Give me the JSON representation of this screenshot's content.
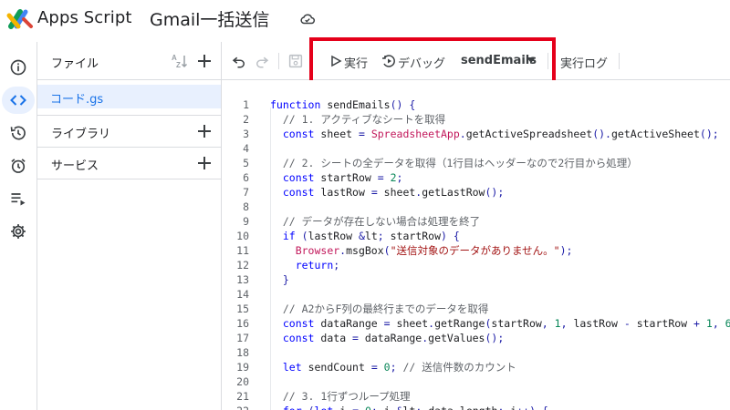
{
  "header": {
    "app_name": "Apps Script",
    "project_title": "Gmail一括送信"
  },
  "rail": {
    "items": [
      {
        "icon": "info-icon"
      },
      {
        "icon": "code-icon",
        "active": true
      },
      {
        "icon": "history-icon"
      },
      {
        "icon": "alarm-icon"
      },
      {
        "icon": "executions-icon"
      },
      {
        "icon": "gear-icon"
      }
    ]
  },
  "files": {
    "title": "ファイル",
    "sort_label": "AZ",
    "active_file": "コード.gs",
    "libraries_label": "ライブラリ",
    "services_label": "サービス"
  },
  "toolbar": {
    "run_label": "実行",
    "debug_label": "デバッグ",
    "function_name": "sendEmails",
    "log_label": "実行ログ"
  },
  "colors": {
    "keyword": "#0000ff",
    "comment": "#5f6368",
    "string": "#a31515",
    "class": "#c2185b",
    "accent": "#1a73e8",
    "highlight": "#e5001a"
  },
  "code": [
    {
      "n": "1",
      "t": "function sendEmails() {"
    },
    {
      "n": "2",
      "t": "  // 1. アクティブなシートを取得"
    },
    {
      "n": "3",
      "t": "  const sheet = SpreadsheetApp.getActiveSpreadsheet().getActiveSheet();"
    },
    {
      "n": "4",
      "t": ""
    },
    {
      "n": "5",
      "t": "  // 2. シートの全データを取得（1行目はヘッダーなので2行目から処理）"
    },
    {
      "n": "6",
      "t": "  const startRow = 2;"
    },
    {
      "n": "7",
      "t": "  const lastRow = sheet.getLastRow();"
    },
    {
      "n": "8",
      "t": ""
    },
    {
      "n": "9",
      "t": "  // データが存在しない場合は処理を終了"
    },
    {
      "n": "10",
      "t": "  if (lastRow < startRow) {"
    },
    {
      "n": "11",
      "t": "    Browser.msgBox(\"送信対象のデータがありません。\");"
    },
    {
      "n": "12",
      "t": "    return;"
    },
    {
      "n": "13",
      "t": "  }"
    },
    {
      "n": "14",
      "t": ""
    },
    {
      "n": "15",
      "t": "  // A2からF列の最終行までのデータを取得"
    },
    {
      "n": "16",
      "t": "  const dataRange = sheet.getRange(startRow, 1, lastRow - startRow + 1, 6"
    },
    {
      "n": "17",
      "t": "  const data = dataRange.getValues();"
    },
    {
      "n": "18",
      "t": ""
    },
    {
      "n": "19",
      "t": "  let sendCount = 0; // 送信件数のカウント"
    },
    {
      "n": "20",
      "t": ""
    },
    {
      "n": "21",
      "t": "  // 3. 1行ずつループ処理"
    },
    {
      "n": "22",
      "t": "  for (let i = 0; i < data.length; i++) {"
    }
  ]
}
